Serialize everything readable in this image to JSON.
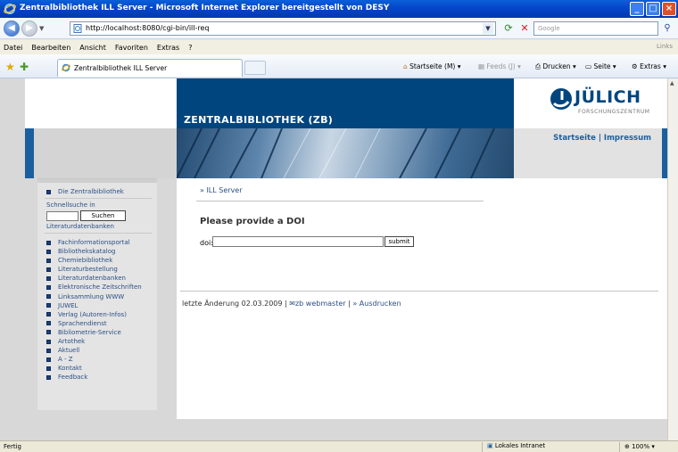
{
  "window": {
    "title": "Zentralbibliothek ILL Server - Microsoft Internet Explorer bereitgestellt von DESY"
  },
  "address_bar": {
    "url": "http://localhost:8080/cgi-bin/ill-req",
    "search_placeholder": "Google"
  },
  "menu": {
    "items": [
      "Datei",
      "Bearbeiten",
      "Ansicht",
      "Favoriten",
      "Extras",
      "?"
    ],
    "links_label": "Links"
  },
  "tab": {
    "label": "Zentralbibliothek ILL Server"
  },
  "commands": {
    "home": "Startseite (M)",
    "feeds": "Feeds (J)",
    "print": "Drucken",
    "page": "Seite",
    "tools": "Extras"
  },
  "page": {
    "banner_title": "ZENTRALBIBLIOTHEK (ZB)",
    "logo_name": "JÜLICH",
    "logo_sub": "FORSCHUNGSZENTRUM",
    "top_links": "Startseite | Impressum",
    "sidebar": {
      "home": "Die Zentralbibliothek",
      "quick_search_label": "Schnellsuche in",
      "search_button": "Suchen",
      "databases_label": "Literaturdatenbanken",
      "items": [
        "Fachinformationsportal",
        "Bibliothekskatalog",
        "Chemiebibliothek",
        "Literaturbestellung",
        "Literaturdatenbanken",
        "Elektronische Zeitschriften",
        "Linksammlung WWW",
        "JUWEL",
        "Verlag (Autoren-Infos)",
        "Sprachendienst",
        "Bibliometrie-Service",
        "Artothek",
        "Aktuell",
        "A - Z",
        "Kontakt",
        "Feedback"
      ]
    },
    "breadcrumb": "» ILL Server",
    "heading": "Please provide a DOI",
    "doi_label": "doi:",
    "doi_value": "",
    "submit_label": "submit",
    "footer": {
      "modified": "letzte Änderung 02.03.2009 |",
      "webmaster": "zb webmaster",
      "sep": "|",
      "print": "» Ausdrucken"
    }
  },
  "status": {
    "text": "Fertig",
    "zone": "Lokales Intranet",
    "zoom": "100%"
  },
  "colors": {
    "brand_blue": "#00457e",
    "link_blue": "#2a4f86"
  }
}
